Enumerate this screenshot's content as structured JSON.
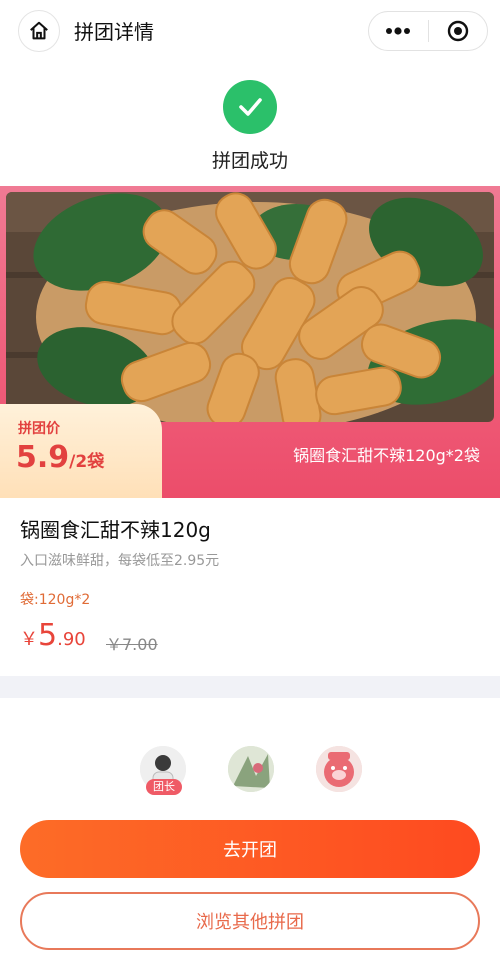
{
  "nav": {
    "title": "拼团详情",
    "home_icon": "home-icon",
    "more_icon": "more-dots-icon",
    "close_icon": "target-circle-icon"
  },
  "status": {
    "text": "拼团成功",
    "icon": "check-icon",
    "color": "#2bc06a"
  },
  "banner": {
    "tag_label": "拼团价",
    "tag_price": "5.9",
    "tag_unit": "/2袋",
    "caption": "锅圈食汇甜不辣120g*2袋"
  },
  "product": {
    "name": "锅圈食汇甜不辣120g",
    "desc": "入口滋味鲜甜，每袋低至2.95元",
    "spec": "袋:120g*2",
    "price_currency": "￥",
    "price_int": "5",
    "price_dec": ".90",
    "original_price": "￥7.00"
  },
  "members": {
    "leader_label": "团长"
  },
  "actions": {
    "primary": "去开团",
    "secondary": "浏览其他拼团"
  },
  "colors": {
    "accent": "#fe5a22",
    "price": "#e8453a",
    "banner": "#ef5d7a"
  }
}
